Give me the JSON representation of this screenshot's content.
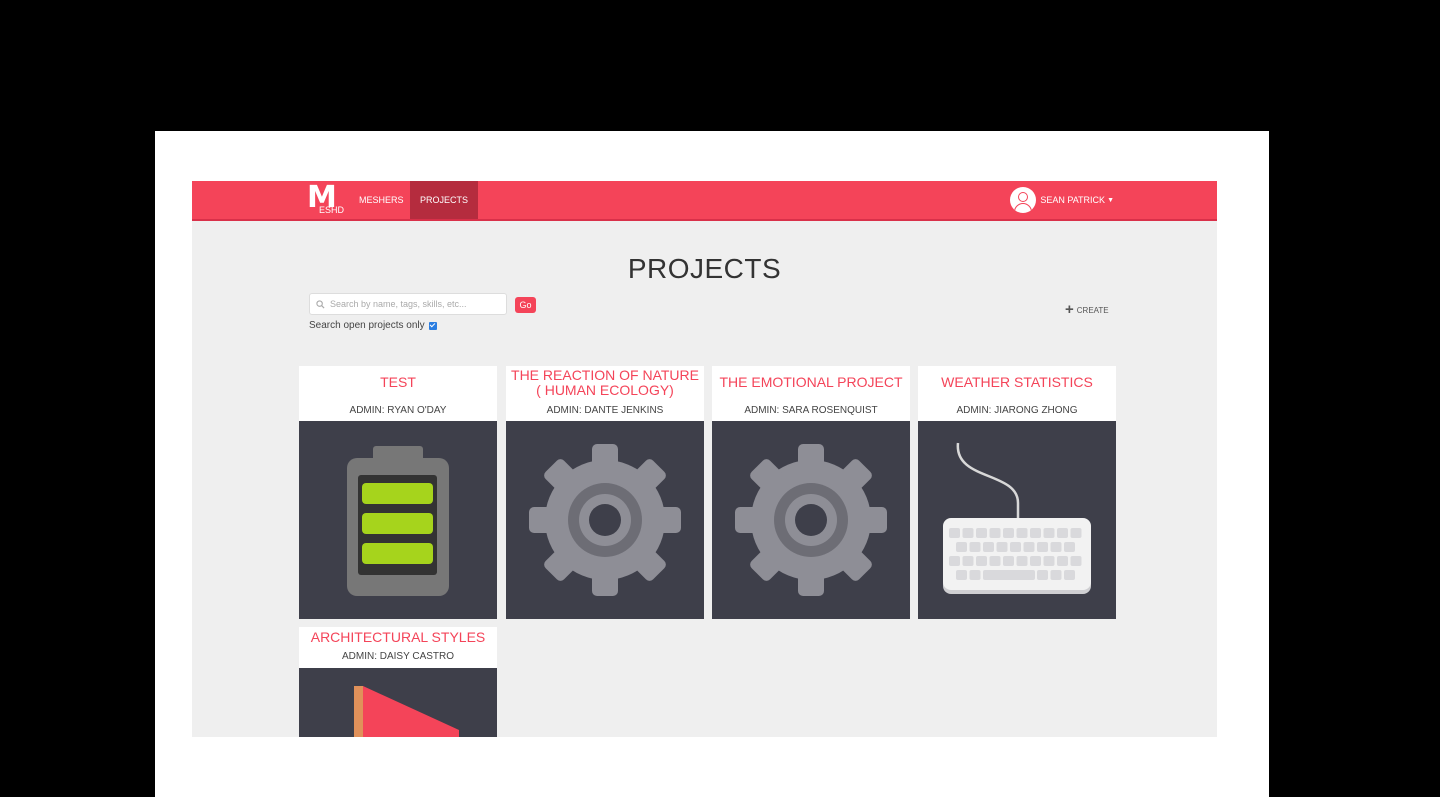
{
  "nav": {
    "logo_main": "M",
    "logo_rest": "ESHD",
    "links": [
      {
        "label": "MESHERS",
        "active": false
      },
      {
        "label": "PROJECTS",
        "active": true
      }
    ],
    "user_name": "SEAN PATRICK",
    "accent_color": "#f44459"
  },
  "page": {
    "title": "PROJECTS"
  },
  "search": {
    "placeholder": "Search by name, tags, skills, etc...",
    "go_label": "Go",
    "open_only_label": "Search open projects only",
    "open_only_checked": true
  },
  "create_label": "CREATE",
  "projects": [
    {
      "title": "TEST",
      "admin": "ADMIN: RYAN O'DAY",
      "icon": "battery-icon"
    },
    {
      "title": "THE REACTION OF NATURE ( HUMAN ECOLOGY)",
      "admin": "ADMIN: DANTE JENKINS",
      "icon": "gear-icon"
    },
    {
      "title": "THE EMOTIONAL PROJECT",
      "admin": "ADMIN: SARA ROSENQUIST",
      "icon": "gear-icon"
    },
    {
      "title": "WEATHER STATISTICS",
      "admin": "ADMIN: JIARONG ZHONG",
      "icon": "keyboard-icon"
    },
    {
      "title": "ARCHITECTURAL STYLES",
      "admin": "ADMIN: DAISY CASTRO",
      "icon": "flag-icon"
    }
  ]
}
